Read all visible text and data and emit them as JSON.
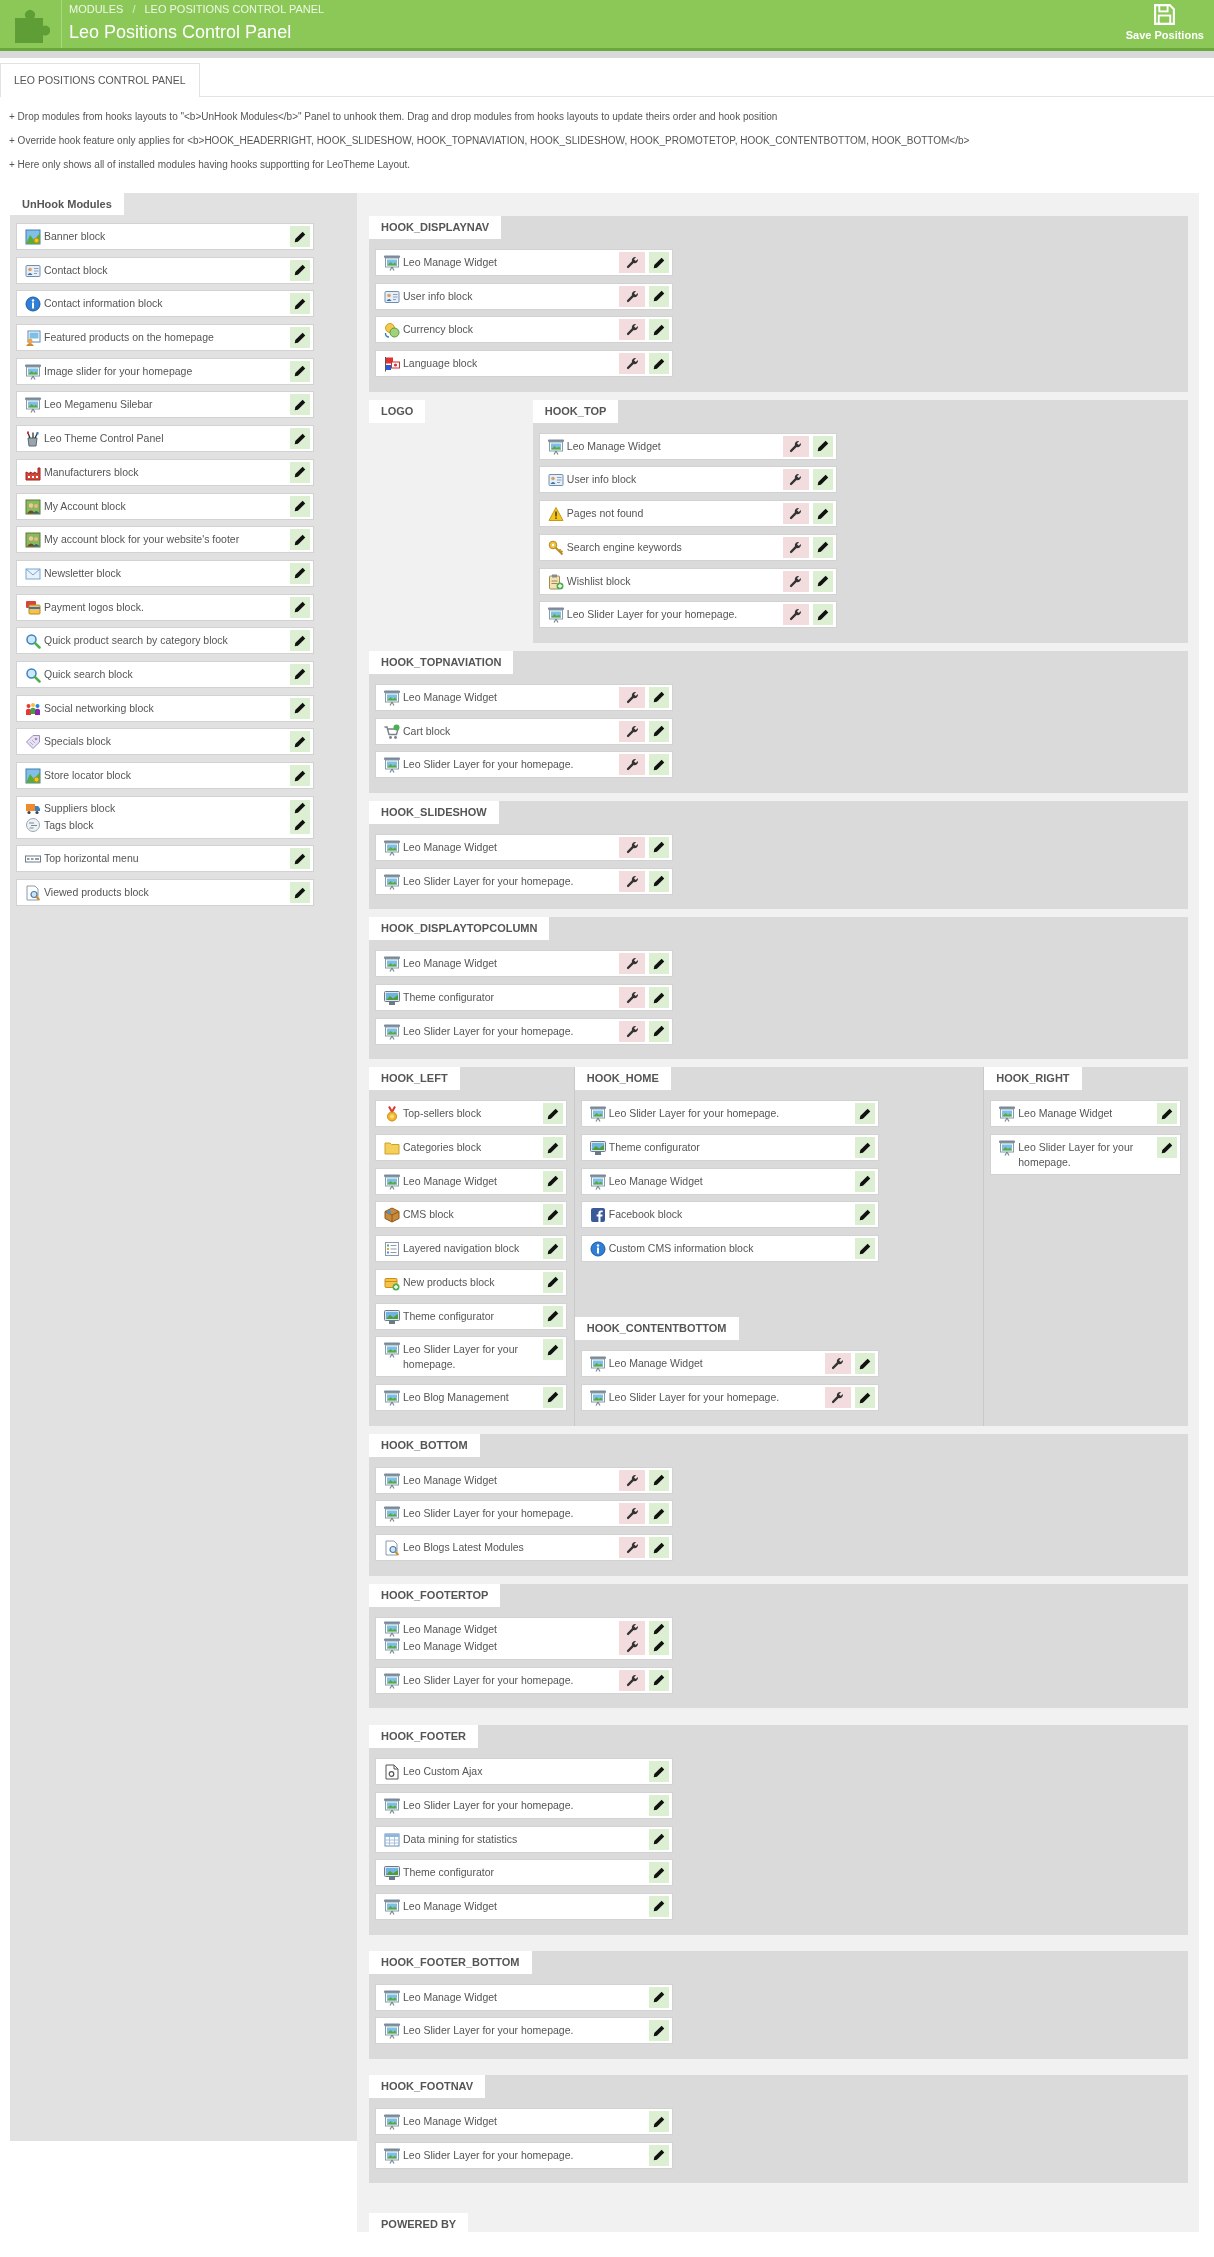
{
  "header": {
    "breadcrumb": [
      "MODULES",
      "LEO POSITIONS CONTROL PANEL"
    ],
    "breadcrumb_separator": "/",
    "title": "Leo Positions Control Panel",
    "save_button": "Save Positions"
  },
  "tabs": [
    {
      "label": "LEO POSITIONS CONTROL PANEL",
      "selected": true
    }
  ],
  "notes": [
    "+ Drop modules from hooks layouts to \"<b>UnHook Modules</b>\" Panel to unhook them. Drag and drop modules from hooks layouts to update theirs order and hook position",
    "+ Override hook feature only applies for <b>HOOK_HEADERRIGHT, HOOK_SLIDESHOW, HOOK_TOPNAVIATION, HOOK_SLIDESHOW, HOOK_PROMOTETOP, HOOK_CONTENTBOTTOM, HOOK_BOTTOM</b>",
    "+ Here only shows all of installed modules having hooks supportting for LeoTheme Layout."
  ],
  "unhook_panel": {
    "title": "UnHook Modules",
    "modules": [
      {
        "name": "Banner block",
        "kind": "map",
        "can_override": false
      },
      {
        "name": "Contact block",
        "kind": "card",
        "can_override": false
      },
      {
        "name": "Contact information block",
        "kind": "info",
        "can_override": false
      },
      {
        "name": "Featured products on the homepage",
        "kind": "featured",
        "can_override": false
      },
      {
        "name": "Image slider for your homepage",
        "kind": "screen",
        "can_override": false
      },
      {
        "name": "Leo Megamenu Silebar",
        "kind": "screen",
        "can_override": false
      },
      {
        "name": "Leo Theme Control Panel",
        "kind": "brushes",
        "can_override": false
      },
      {
        "name": "Manufacturers block",
        "kind": "factory",
        "can_override": false
      },
      {
        "name": "My Account block",
        "kind": "users",
        "can_override": false
      },
      {
        "name": "My account block for your website's footer",
        "kind": "users",
        "can_override": false
      },
      {
        "name": "Newsletter block",
        "kind": "envelope",
        "can_override": false
      },
      {
        "name": "Payment logos block.",
        "kind": "payment",
        "can_override": false
      },
      {
        "name": "Quick product search by category block",
        "kind": "search",
        "can_override": false
      },
      {
        "name": "Quick search block",
        "kind": "search",
        "can_override": false
      },
      {
        "name": "Social networking block",
        "kind": "social",
        "can_override": false
      },
      {
        "name": "Specials block",
        "kind": "specials",
        "can_override": false
      },
      {
        "name": "Store locator block",
        "kind": "map",
        "can_override": false
      },
      {
        "stack": [
          {
            "name": "Suppliers block",
            "kind": "truck",
            "can_override": false
          },
          {
            "name": "Tags block",
            "kind": "tags",
            "can_override": false
          }
        ]
      },
      {
        "name": "Top horizontal menu",
        "kind": "menubar",
        "can_override": false
      },
      {
        "name": "Viewed products block",
        "kind": "docsearch",
        "can_override": false
      }
    ]
  },
  "rows": [
    {
      "columns": [
        {
          "hooks": [
            {
              "kind": "hook",
              "title": "HOOK_DISPLAYNAV",
              "modules": [
                {
                  "name": "Leo Manage Widget",
                  "kind": "screen",
                  "can_override": true
                },
                {
                  "name": "User info block",
                  "kind": "card",
                  "can_override": true
                },
                {
                  "name": "Currency block",
                  "kind": "coins",
                  "can_override": true
                },
                {
                  "name": "Language block",
                  "kind": "flags",
                  "can_override": true
                }
              ]
            }
          ]
        }
      ]
    },
    {
      "columns": [
        {
          "hooks": [
            {
              "kind": "position",
              "title": "LOGO"
            }
          ]
        },
        {
          "hooks": [
            {
              "kind": "hook",
              "title": "HOOK_TOP",
              "modules": [
                {
                  "name": "Leo Manage Widget",
                  "kind": "screen",
                  "can_override": true
                },
                {
                  "name": "User info block",
                  "kind": "card",
                  "can_override": true
                },
                {
                  "name": "Pages not found",
                  "kind": "warning",
                  "can_override": true
                },
                {
                  "name": "Search engine keywords",
                  "kind": "keys",
                  "can_override": true
                },
                {
                  "name": "Wishlist block",
                  "kind": "clipboard",
                  "can_override": true
                },
                {
                  "name": "Leo Slider Layer for your homepage.",
                  "kind": "screen",
                  "can_override": true
                }
              ]
            }
          ]
        }
      ]
    },
    {
      "columns": [
        {
          "hooks": [
            {
              "kind": "hook",
              "title": "HOOK_TOPNAVIATION",
              "modules": [
                {
                  "name": "Leo Manage Widget",
                  "kind": "screen",
                  "can_override": true
                },
                {
                  "name": "Cart block",
                  "kind": "cart",
                  "can_override": true
                },
                {
                  "name": "Leo Slider Layer for your homepage.",
                  "kind": "screen",
                  "can_override": true
                }
              ]
            }
          ]
        }
      ]
    },
    {
      "columns": [
        {
          "hooks": [
            {
              "kind": "hook",
              "title": "HOOK_SLIDESHOW",
              "modules": [
                {
                  "name": "Leo Manage Widget",
                  "kind": "screen",
                  "can_override": true
                },
                {
                  "name": "Leo Slider Layer for your homepage.",
                  "kind": "screen",
                  "can_override": true
                }
              ]
            }
          ]
        }
      ]
    },
    {
      "columns": [
        {
          "hooks": [
            {
              "kind": "hook",
              "title": "HOOK_DISPLAYTOPCOLUMN",
              "modules": [
                {
                  "name": "Leo Manage Widget",
                  "kind": "screen",
                  "can_override": true
                },
                {
                  "name": "Theme configurator",
                  "kind": "monitor",
                  "can_override": true
                },
                {
                  "name": "Leo Slider Layer for your homepage.",
                  "kind": "screen",
                  "can_override": true
                }
              ]
            }
          ]
        }
      ]
    },
    {
      "columns": [
        {
          "hooks": [
            {
              "kind": "hook",
              "title": "HOOK_LEFT",
              "modules": [
                {
                  "name": "Top-sellers block",
                  "kind": "medal",
                  "can_override": false
                },
                {
                  "name": "Categories block",
                  "kind": "folder",
                  "can_override": false
                },
                {
                  "name": "Leo Manage Widget",
                  "kind": "screen",
                  "can_override": false
                },
                {
                  "name": "CMS block",
                  "kind": "box",
                  "can_override": false
                },
                {
                  "name": "Layered navigation block",
                  "kind": "list",
                  "can_override": false
                },
                {
                  "name": "New products block",
                  "kind": "package",
                  "can_override": false
                },
                {
                  "name": "Theme configurator",
                  "kind": "monitor",
                  "can_override": false
                },
                {
                  "name": "Leo Slider Layer for your homepage.",
                  "kind": "screen",
                  "can_override": false
                },
                {
                  "name": "Leo Blog Management",
                  "kind": "screen",
                  "can_override": false
                }
              ]
            }
          ]
        },
        {
          "hooks": [
            {
              "kind": "hook",
              "title": "HOOK_HOME",
              "modules": [
                {
                  "name": "Leo Slider Layer for your homepage.",
                  "kind": "screen",
                  "can_override": false
                },
                {
                  "name": "Theme configurator",
                  "kind": "monitor",
                  "can_override": false
                },
                {
                  "name": "Leo Manage Widget",
                  "kind": "screen",
                  "can_override": false
                },
                {
                  "name": "Facebook block",
                  "kind": "facebook",
                  "can_override": false
                },
                {
                  "name": "Custom CMS information block",
                  "kind": "info",
                  "can_override": false
                }
              ]
            },
            {
              "kind": "hook",
              "title": "HOOK_CONTENTBOTTOM",
              "modules": [
                {
                  "name": "Leo Manage Widget",
                  "kind": "screen",
                  "can_override": true
                },
                {
                  "name": "Leo Slider Layer for your homepage.",
                  "kind": "screen",
                  "can_override": true
                }
              ]
            }
          ]
        },
        {
          "hooks": [
            {
              "kind": "hook",
              "title": "HOOK_RIGHT",
              "modules": [
                {
                  "name": "Leo Manage Widget",
                  "kind": "screen",
                  "can_override": false
                },
                {
                  "name": "Leo Slider Layer for your homepage.",
                  "kind": "screen",
                  "can_override": false
                }
              ]
            }
          ]
        }
      ]
    },
    {
      "columns": [
        {
          "hooks": [
            {
              "kind": "hook",
              "title": "HOOK_BOTTOM",
              "modules": [
                {
                  "name": "Leo Manage Widget",
                  "kind": "screen",
                  "can_override": true
                },
                {
                  "name": "Leo Slider Layer for your homepage.",
                  "kind": "screen",
                  "can_override": true
                },
                {
                  "name": "Leo Blogs Latest Modules",
                  "kind": "docsearch",
                  "can_override": true
                }
              ]
            }
          ]
        }
      ]
    },
    {
      "columns": [
        {
          "hooks": [
            {
              "kind": "hook",
              "title": "HOOK_FOOTERTOP",
              "modules": [
                {
                  "stack": [
                    {
                      "name": "Leo Manage Widget",
                      "kind": "screen",
                      "can_override": true
                    },
                    {
                      "name": "Leo Manage Widget",
                      "kind": "screen",
                      "can_override": true
                    }
                  ]
                },
                {
                  "name": "Leo Slider Layer for your homepage.",
                  "kind": "screen",
                  "can_override": true
                }
              ]
            }
          ]
        }
      ]
    }
  ],
  "footer_rows": [
    {
      "columns": [
        {
          "hooks": [
            {
              "kind": "hook",
              "title": "HOOK_FOOTER",
              "modules": [
                {
                  "name": "Leo Custom Ajax",
                  "kind": "document",
                  "can_override": false
                },
                {
                  "name": "Leo Slider Layer for your homepage.",
                  "kind": "screen",
                  "can_override": false
                },
                {
                  "name": "Data mining for statistics",
                  "kind": "table",
                  "can_override": false
                },
                {
                  "name": "Theme configurator",
                  "kind": "monitor",
                  "can_override": false
                },
                {
                  "name": "Leo Manage Widget",
                  "kind": "screen",
                  "can_override": false
                }
              ]
            }
          ]
        }
      ]
    },
    {
      "columns": [
        {
          "hooks": [
            {
              "kind": "hook",
              "title": "HOOK_FOOTER_BOTTOM",
              "modules": [
                {
                  "name": "Leo Manage Widget",
                  "kind": "screen",
                  "can_override": false
                },
                {
                  "name": "Leo Slider Layer for your homepage.",
                  "kind": "screen",
                  "can_override": false
                }
              ]
            }
          ]
        }
      ]
    },
    {
      "columns": [
        {
          "hooks": [
            {
              "kind": "hook",
              "title": "HOOK_FOOTNAV",
              "modules": [
                {
                  "name": "Leo Manage Widget",
                  "kind": "screen",
                  "can_override": false
                },
                {
                  "name": "Leo Slider Layer for your homepage.",
                  "kind": "screen",
                  "can_override": false
                }
              ]
            }
          ]
        }
      ]
    }
  ],
  "credits": {
    "title": "POWERED BY"
  }
}
